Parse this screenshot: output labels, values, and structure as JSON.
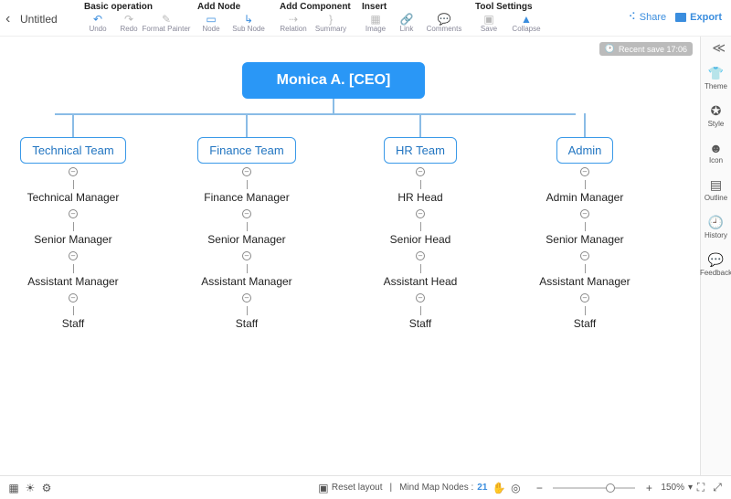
{
  "header": {
    "title": "Untitled",
    "groups": {
      "basic": {
        "label": "Basic operation",
        "undo": "Undo",
        "redo": "Redo",
        "format_painter": "Format Painter"
      },
      "add_node": {
        "label": "Add Node",
        "node": "Node",
        "sub_node": "Sub Node"
      },
      "add_component": {
        "label": "Add Component",
        "relation": "Relation",
        "summary": "Summary"
      },
      "insert": {
        "label": "Insert",
        "image": "Image",
        "link": "Link",
        "comments": "Comments"
      },
      "tool_settings": {
        "label": "Tool Settings",
        "save": "Save",
        "collapse": "Collapse"
      }
    },
    "share": "Share",
    "export": "Export"
  },
  "recent_save": "Recent save 17:06",
  "diagram": {
    "root": "Monica A. [CEO]",
    "branches": {
      "technical": {
        "team": "Technical Team",
        "r1": "Technical Manager",
        "r2": "Senior Manager",
        "r3": "Assistant Manager",
        "r4": "Staff"
      },
      "finance": {
        "team": "Finance Team",
        "r1": "Finance Manager",
        "r2": "Senior Manager",
        "r3": "Assistant Manager",
        "r4": "Staff"
      },
      "hr": {
        "team": "HR Team",
        "r1": "HR Head",
        "r2": "Senior Head",
        "r3": "Assistant Head",
        "r4": "Staff"
      },
      "admin": {
        "team": "Admin",
        "r1": "Admin Manager",
        "r2": "Senior Manager",
        "r3": "Assistant Manager",
        "r4": "Staff"
      }
    }
  },
  "sidepanel": {
    "theme": "Theme",
    "style": "Style",
    "icon": "Icon",
    "outline": "Outline",
    "history": "History",
    "feedback": "Feedback"
  },
  "bottombar": {
    "reset_layout": "Reset layout",
    "nodes_label": "Mind Map Nodes :",
    "nodes_count": "21",
    "zoom_value": "150%"
  }
}
